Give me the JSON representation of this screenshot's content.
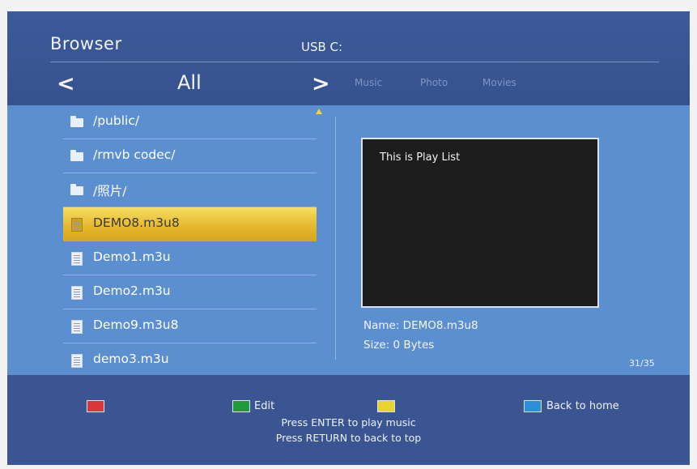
{
  "header": {
    "title": "Browser",
    "device": "USB C:",
    "nav": {
      "current": "All",
      "prev_symbol": "<",
      "next_symbol": ">",
      "tabs": [
        "Music",
        "Photo",
        "Movies"
      ]
    }
  },
  "file_list": {
    "items": [
      {
        "label": "/public/",
        "type": "folder"
      },
      {
        "label": "/rmvb codec/",
        "type": "folder"
      },
      {
        "label": "/照片/",
        "type": "folder"
      },
      {
        "label": "DEMO8.m3u8",
        "type": "file",
        "selected": true
      },
      {
        "label": "Demo1.m3u",
        "type": "file"
      },
      {
        "label": "Demo2.m3u",
        "type": "file"
      },
      {
        "label": "Demo9.m3u8",
        "type": "file"
      },
      {
        "label": "demo3.m3u",
        "type": "file"
      }
    ]
  },
  "preview": {
    "text": "This is Play List",
    "name": "Name: DEMO8.m3u8",
    "size": "Size: 0 Bytes",
    "page_counter": "31/35"
  },
  "footer": {
    "keys": [
      {
        "color": "#d9363a",
        "label": ""
      },
      {
        "color": "#1f9c3a",
        "label": "Edit"
      },
      {
        "color": "#e9d52a",
        "label": ""
      },
      {
        "color": "#2b8fd8",
        "label": "Back to home"
      }
    ],
    "hint_1": "Press ENTER to play music",
    "hint_2": "Press RETURN to back to top"
  },
  "colors": {
    "background": "#3a5592",
    "list_panel": "#5b8fd0",
    "selection": "#e4b62b"
  }
}
